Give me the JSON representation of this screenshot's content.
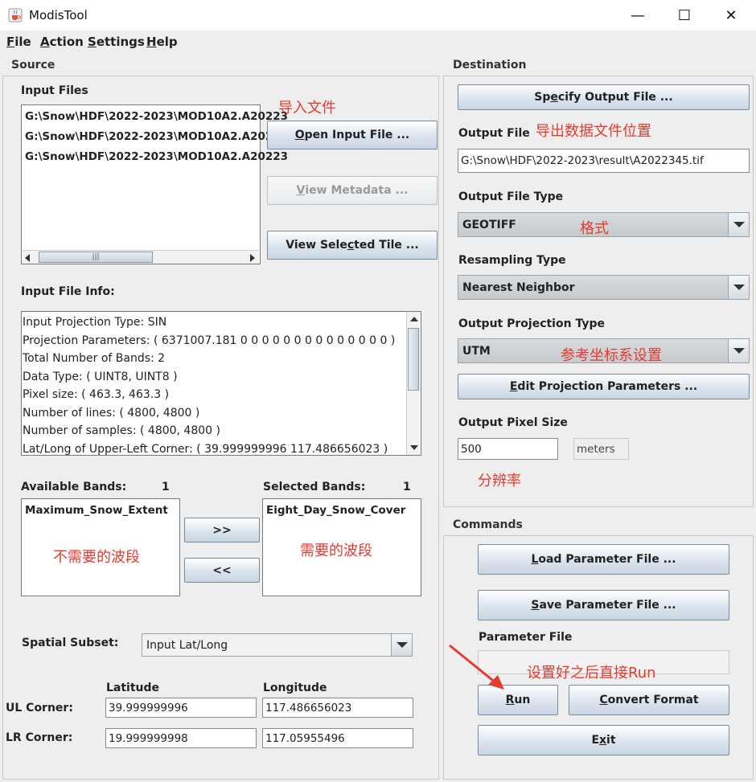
{
  "window": {
    "title": "ModisTool",
    "minimize": "—",
    "maximize": "☐",
    "close": "✕"
  },
  "menu": [
    {
      "pre": "",
      "u": "F",
      "post": "ile"
    },
    {
      "pre": "",
      "u": "A",
      "post": "ction"
    },
    {
      "pre": "",
      "u": "S",
      "post": "ettings"
    },
    {
      "pre": "",
      "u": "H",
      "post": "elp"
    }
  ],
  "source": {
    "label": "Source",
    "input_files_label": "Input Files",
    "files": [
      "G:\\Snow\\HDF\\2022-2023\\MOD10A2.A20223",
      "G:\\Snow\\HDF\\2022-2023\\MOD10A2.A20223",
      "G:\\Snow\\HDF\\2022-2023\\MOD10A2.A20223"
    ],
    "open_btn": {
      "pre": "",
      "u": "O",
      "post": "pen Input File ..."
    },
    "metadata_btn": {
      "pre": "",
      "u": "V",
      "post": "iew Metadata ..."
    },
    "view_tile_btn": {
      "pre": "View Sele",
      "u": "c",
      "post": "ted Tile  ..."
    },
    "info_label": "Input File Info:",
    "info_lines": [
      "Input Projection Type: SIN",
      "Projection Parameters: ( 6371007.181 0 0 0 0 0 0 0 0 0 0 0 0 0 0 )",
      "Total Number of Bands: 2",
      "Data Type: ( UINT8, UINT8 )",
      "Pixel size: ( 463.3, 463.3 )",
      "Number of lines: ( 4800, 4800 )",
      "Number of samples: ( 4800, 4800 )",
      "Lat/Long of Upper-Left Corner: ( 39.999999996 117.486656023 )"
    ],
    "available_label": "Available Bands:",
    "available_count": "1",
    "available_bands": [
      "Maximum_Snow_Extent"
    ],
    "selected_label": "Selected Bands:",
    "selected_count": "1",
    "selected_bands": [
      "Eight_Day_Snow_Cover"
    ],
    "add_btn": ">>",
    "remove_btn": "<<",
    "subset_label": "Spatial Subset:",
    "subset_value": "Input Lat/Long",
    "lat_label": "Latitude",
    "lon_label": "Longitude",
    "ul_label": "UL Corner:",
    "lr_label": "LR Corner:",
    "ul_lat": "39.999999996",
    "ul_lon": "117.486656023",
    "lr_lat": "19.999999998",
    "lr_lon": "117.05955496"
  },
  "destination": {
    "label": "Destination",
    "specify_btn": {
      "pre": "Sp",
      "u": "e",
      "post": "cify Output File ..."
    },
    "output_file_label": "Output File",
    "output_file_value": "G:\\Snow\\HDF\\2022-2023\\result\\A2022345.tif",
    "file_type_label": "Output File Type",
    "file_type_value": "GEOTIFF",
    "resampling_label": "Resampling Type",
    "resampling_value": "Nearest Neighbor",
    "projection_label": "Output Projection Type",
    "projection_value": "UTM",
    "edit_proj_btn": {
      "pre": "",
      "u": "E",
      "post": "dit Projection Parameters ..."
    },
    "pixel_size_label": "Output Pixel Size",
    "pixel_size_value": "500",
    "pixel_unit": "meters"
  },
  "commands": {
    "label": "Commands",
    "load_btn": {
      "pre": "",
      "u": "L",
      "post": "oad Parameter File ..."
    },
    "save_btn": {
      "pre": "",
      "u": "S",
      "post": "ave Parameter File ..."
    },
    "param_label": "Parameter File",
    "param_value": "",
    "run_btn": {
      "pre": "",
      "u": "R",
      "post": "un"
    },
    "convert_btn": {
      "pre": "",
      "u": "C",
      "post": "onvert Format"
    },
    "exit_btn": {
      "pre": "E",
      "u": "x",
      "post": "it"
    }
  },
  "annotations": {
    "import_files": "导入文件",
    "export_location": "导出数据文件位置",
    "format": "格式",
    "crs_setting": "参考坐标系设置",
    "resolution": "分辨率",
    "unneeded_bands": "不需要的波段",
    "needed_bands": "需要的波段",
    "run_hint": "设置好之后直接Run"
  },
  "colors": {
    "annotation": "#e43a2f",
    "button_top": "#ffffff",
    "button_bottom": "#c9d6e3"
  }
}
